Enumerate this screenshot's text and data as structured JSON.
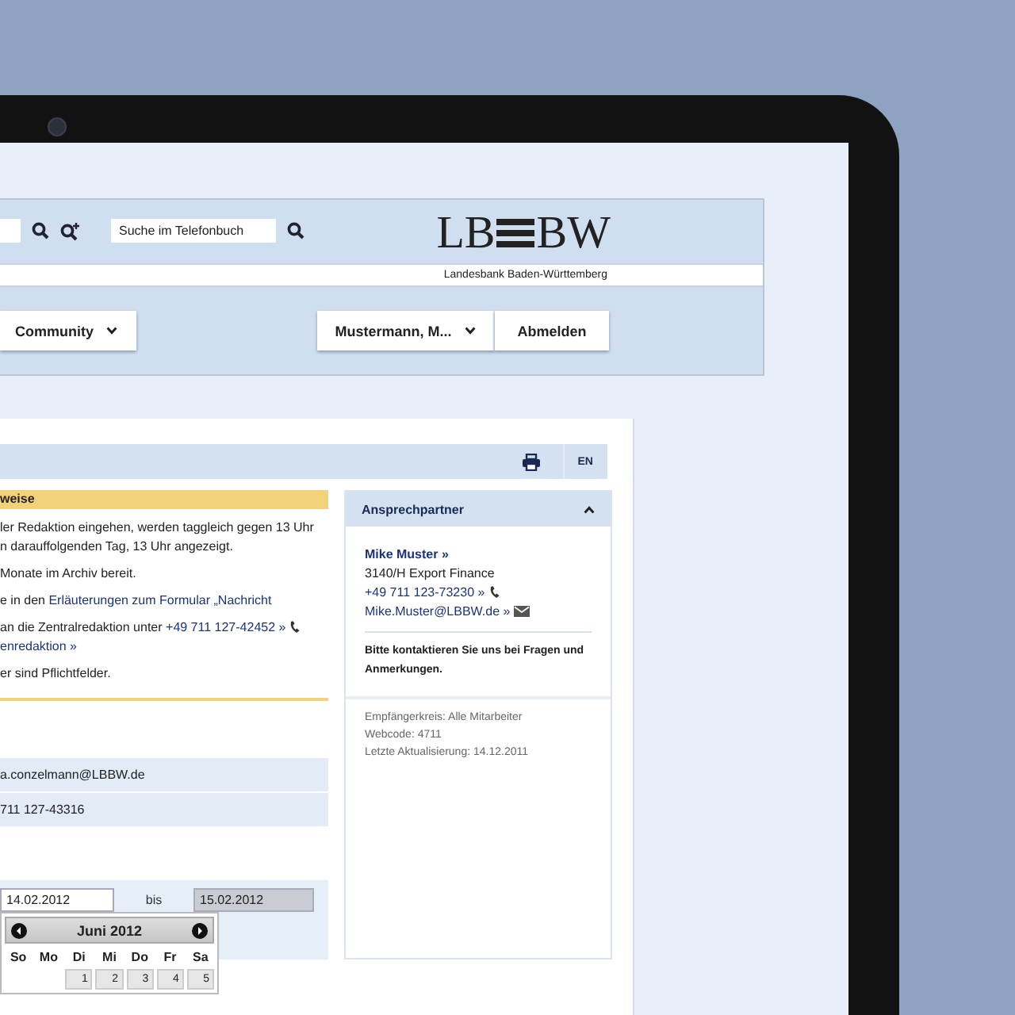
{
  "header": {
    "phonebook_search": {
      "placeholder": "Suche im Telefonbuch"
    },
    "logo_left": "LB",
    "logo_right": "BW",
    "logo_subtitle": "Landesbank Baden-Württemberg"
  },
  "nav": {
    "menu": [
      {
        "label": "Community"
      }
    ],
    "user": {
      "label": "Mustermann, M..."
    },
    "logout": "Abmelden"
  },
  "toolbar": {
    "language": "EN"
  },
  "notice": {
    "heading": "weise",
    "paragraphs": [
      {
        "lines": [
          [
            {
              "kind": "text",
              "text": "ler Redaktion eingehen, werden taggleich gegen 13 Uhr"
            }
          ],
          [
            {
              "kind": "text",
              "text": "n darauffolgenden Tag, 13 Uhr angezeigt."
            }
          ]
        ]
      },
      {
        "lines": [
          [
            {
              "kind": "text",
              "text": "Monate im Archiv bereit."
            }
          ]
        ]
      },
      {
        "lines": [
          [
            {
              "kind": "text",
              "text": "e in den "
            },
            {
              "kind": "link",
              "text": "Erläuterungen zum Formular „Nachricht"
            }
          ]
        ]
      },
      {
        "lines": [
          [
            {
              "kind": "text",
              "text": "an die Zentralredaktion unter "
            },
            {
              "kind": "phone_link",
              "text": "+49 711 127-42452 »"
            }
          ],
          [
            {
              "kind": "link",
              "text": "enredaktion »"
            }
          ]
        ]
      },
      {
        "lines": [
          [
            {
              "kind": "text",
              "text": "er sind Pflichtfelder."
            }
          ]
        ]
      }
    ]
  },
  "fields": [
    "a.conzelmann@LBBW.de",
    "711 127-43316"
  ],
  "date_range": {
    "from": "14.02.2012",
    "separator": "bis",
    "to": "15.02.2012",
    "to_disabled": true
  },
  "calendar": {
    "month": "Juni 2012",
    "weekdays": [
      "So",
      "Mo",
      "Di",
      "Mi",
      "Do",
      "Fr",
      "Sa"
    ],
    "first_row": [
      {
        "kind": "blank"
      },
      {
        "kind": "blank"
      },
      {
        "kind": "day",
        "label": "1"
      },
      {
        "kind": "day",
        "label": "2"
      },
      {
        "kind": "day",
        "label": "3"
      },
      {
        "kind": "day",
        "label": "4"
      },
      {
        "kind": "day",
        "label": "5"
      }
    ]
  },
  "contact": {
    "title": "Ansprechpartner",
    "expanded": true,
    "name": "Mike Muster »",
    "department": "3140/H Export Finance",
    "phone": "+49 711 123-73230 »",
    "email": "Mike.Muster@LBBW.de »",
    "note": "Bitte kontaktieren Sie uns bei Fragen und Anmerkungen.",
    "meta": [
      "Empfängerkreis: Alle Mitarbeiter",
      "Webcode: 4711",
      "Letzte Aktualisierung: 14.12.2011"
    ]
  }
}
